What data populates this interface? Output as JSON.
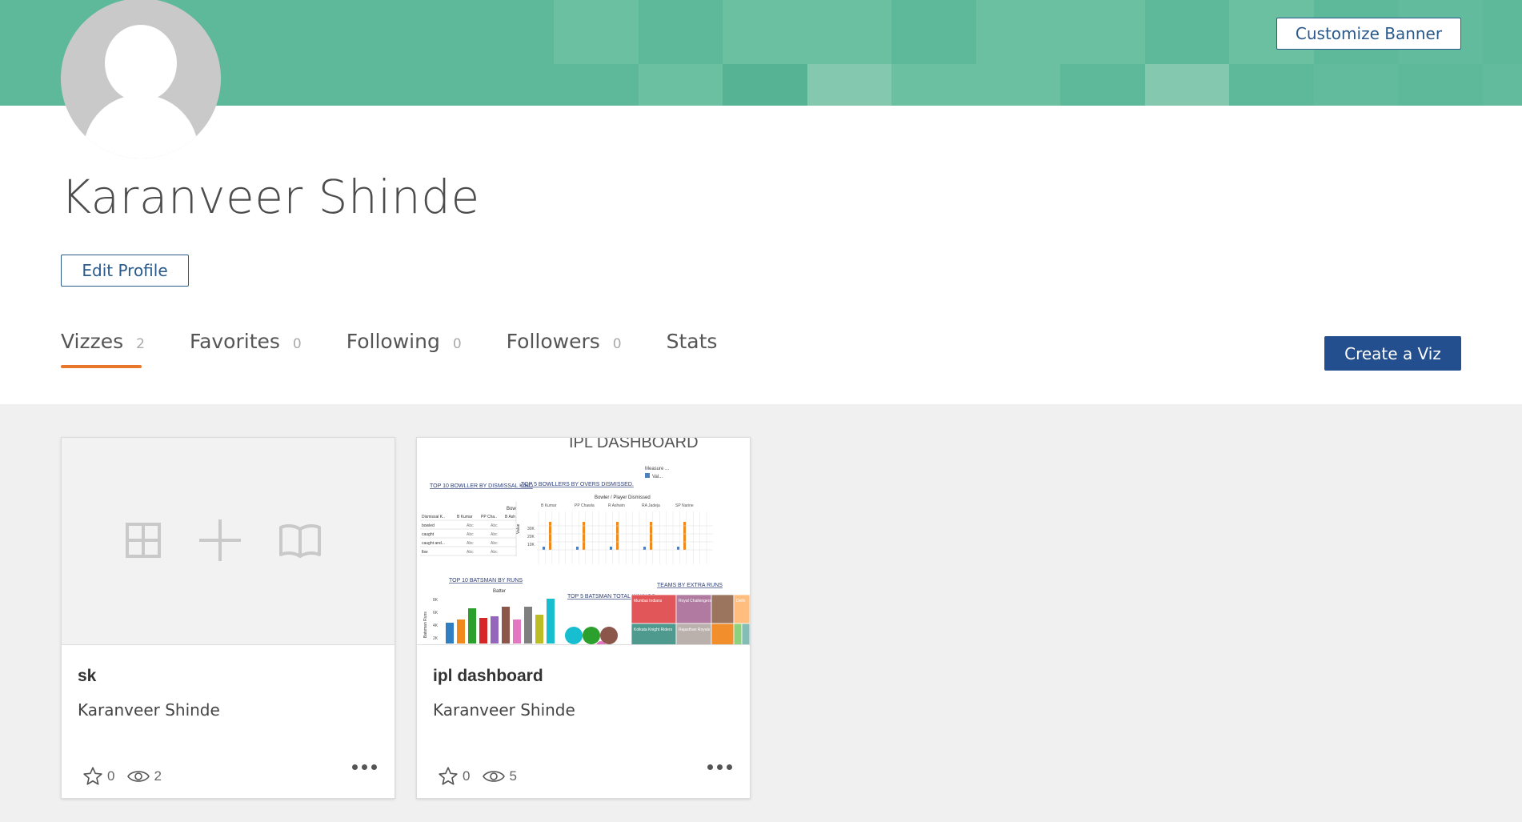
{
  "banner": {
    "customize_label": "Customize Banner",
    "base_color": "#5eb89a",
    "cell_colors": [
      "#6cc0a2",
      "#5eb89a",
      "#6cc0a2",
      "#6cc0a2",
      "#5eb89a",
      "#6cc0a2",
      "#6cc0a2",
      "#5eb89a",
      "#6cc0a2",
      "#5eb89a",
      "#63bb9d",
      "#5eb89a",
      "#5eb89a",
      "#6cc0a2",
      "#56b393",
      "#84c9af",
      "#6cc0a2",
      "#6cc0a2",
      "#5eb89a",
      "#84c9af",
      "#5eb89a",
      "#63bb9d",
      "#5eb89a",
      "#63bb9d"
    ]
  },
  "profile": {
    "name": "Karanveer Shinde",
    "edit_label": "Edit Profile"
  },
  "tabs": [
    {
      "label": "Vizzes",
      "count": "2"
    },
    {
      "label": "Favorites",
      "count": "0"
    },
    {
      "label": "Following",
      "count": "0"
    },
    {
      "label": "Followers",
      "count": "0"
    },
    {
      "label": "Stats",
      "count": ""
    }
  ],
  "create_label": "Create a Viz",
  "cards": [
    {
      "title": "sk",
      "author": "Karanveer Shinde",
      "favorites": "0",
      "views": "2"
    },
    {
      "title": "ipl dashboard",
      "author": "Karanveer Shinde",
      "favorites": "0",
      "views": "5"
    }
  ],
  "thumbnail": {
    "header": "IPL DASHBOARD",
    "legend_title": "Measure ...",
    "legend_item": "Val...",
    "bowler_kind_title": "TOP 10 BOWLLER BY DISMISSAL KIND",
    "overs_title": "TOP 5 BOWLLERS BY OVERS DISMISSED.",
    "bowler_sub": "Bowler / Player Dismissed",
    "bowlers": [
      "B Kumar",
      "PP Chawla",
      "R Ashwin",
      "RA Jadeja",
      "SP Narine"
    ],
    "kind_rows": [
      "Dismissal K..",
      "bowled",
      "caught",
      "caught and...",
      "lbw"
    ],
    "kind_cols": [
      "B Kumar",
      "PP Cha..",
      "B Ash"
    ],
    "cell_text": "Abc",
    "bow_header": "Bow",
    "y_ticks_small": [
      "30K",
      "20K",
      "10K"
    ],
    "value_label": "Value",
    "batsman_title": "TOP 10 BATSMAN BY RUNS",
    "batter_label": "Batter",
    "batsman_axis": "Batsman Runs",
    "batsman_ticks": [
      "8K",
      "6K",
      "4K",
      "2K"
    ],
    "innings_title": "TOP 5 BATSMAN TOTAL INNINGS",
    "extra_title": "TEAMS BY EXTRA RUNS",
    "teams": [
      "Mumbai Indians",
      "Royal Challengers",
      "Delhi",
      "Kolkata Knight Riders",
      "Rajasthan Royals"
    ]
  }
}
